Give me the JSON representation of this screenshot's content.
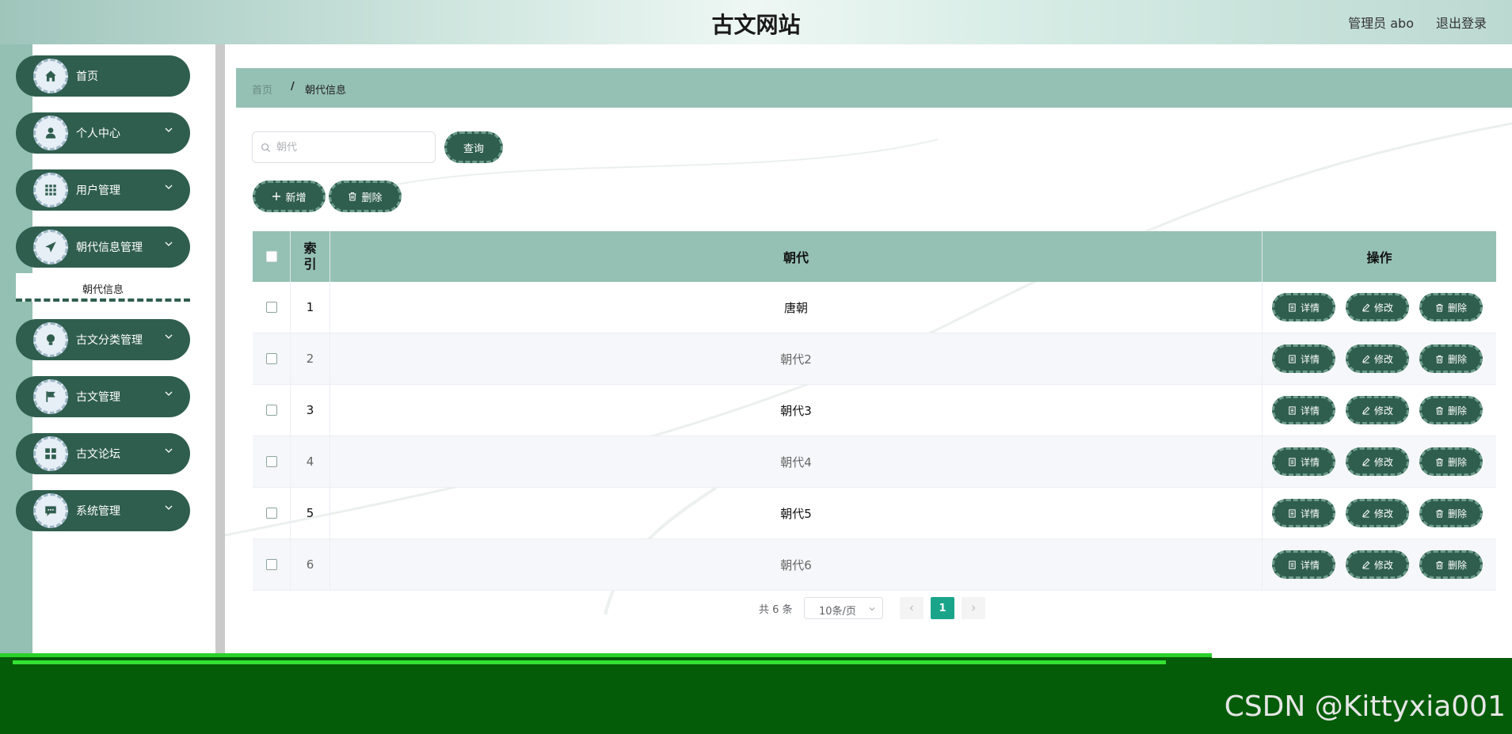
{
  "header": {
    "title": "古文网站",
    "user_label": "管理员 abo",
    "logout_label": "退出登录"
  },
  "sidebar": {
    "items": [
      {
        "label": "首页",
        "icon": "home-icon"
      },
      {
        "label": "个人中心",
        "icon": "user-icon"
      },
      {
        "label": "用户管理",
        "icon": "grid-icon"
      },
      {
        "label": "朝代信息管理",
        "icon": "send-icon"
      },
      {
        "label": "古文分类管理",
        "icon": "bulb-icon"
      },
      {
        "label": "古文管理",
        "icon": "flag-icon"
      },
      {
        "label": "古文论坛",
        "icon": "apps-icon"
      },
      {
        "label": "系统管理",
        "icon": "chat-icon"
      }
    ],
    "submenu": {
      "label": "朝代信息"
    }
  },
  "breadcrumb": {
    "home": "首页",
    "separator": "/",
    "current": "朝代信息"
  },
  "search": {
    "placeholder": "朝代",
    "value": "",
    "button_label": "查询"
  },
  "toolbar": {
    "add_label": "新增",
    "delete_label": "删除"
  },
  "table": {
    "headers": {
      "index": "索\n引",
      "dynasty": "朝代",
      "actions": "操作"
    },
    "rows": [
      {
        "index": "1",
        "dynasty": "唐朝"
      },
      {
        "index": "2",
        "dynasty": "朝代2"
      },
      {
        "index": "3",
        "dynasty": "朝代3"
      },
      {
        "index": "4",
        "dynasty": "朝代4"
      },
      {
        "index": "5",
        "dynasty": "朝代5"
      },
      {
        "index": "6",
        "dynasty": "朝代6"
      }
    ],
    "row_actions": {
      "detail": "详情",
      "edit": "修改",
      "delete": "删除"
    }
  },
  "pagination": {
    "total": "共 6 条",
    "page_size": "10条/页",
    "current_page": "1"
  },
  "watermark": "CSDN @Kittyxia001",
  "colors": {
    "primary": "#2f5e4e",
    "header_bg": "#95c1b4",
    "page_active": "#1aa58a",
    "footer": "#045c08"
  }
}
